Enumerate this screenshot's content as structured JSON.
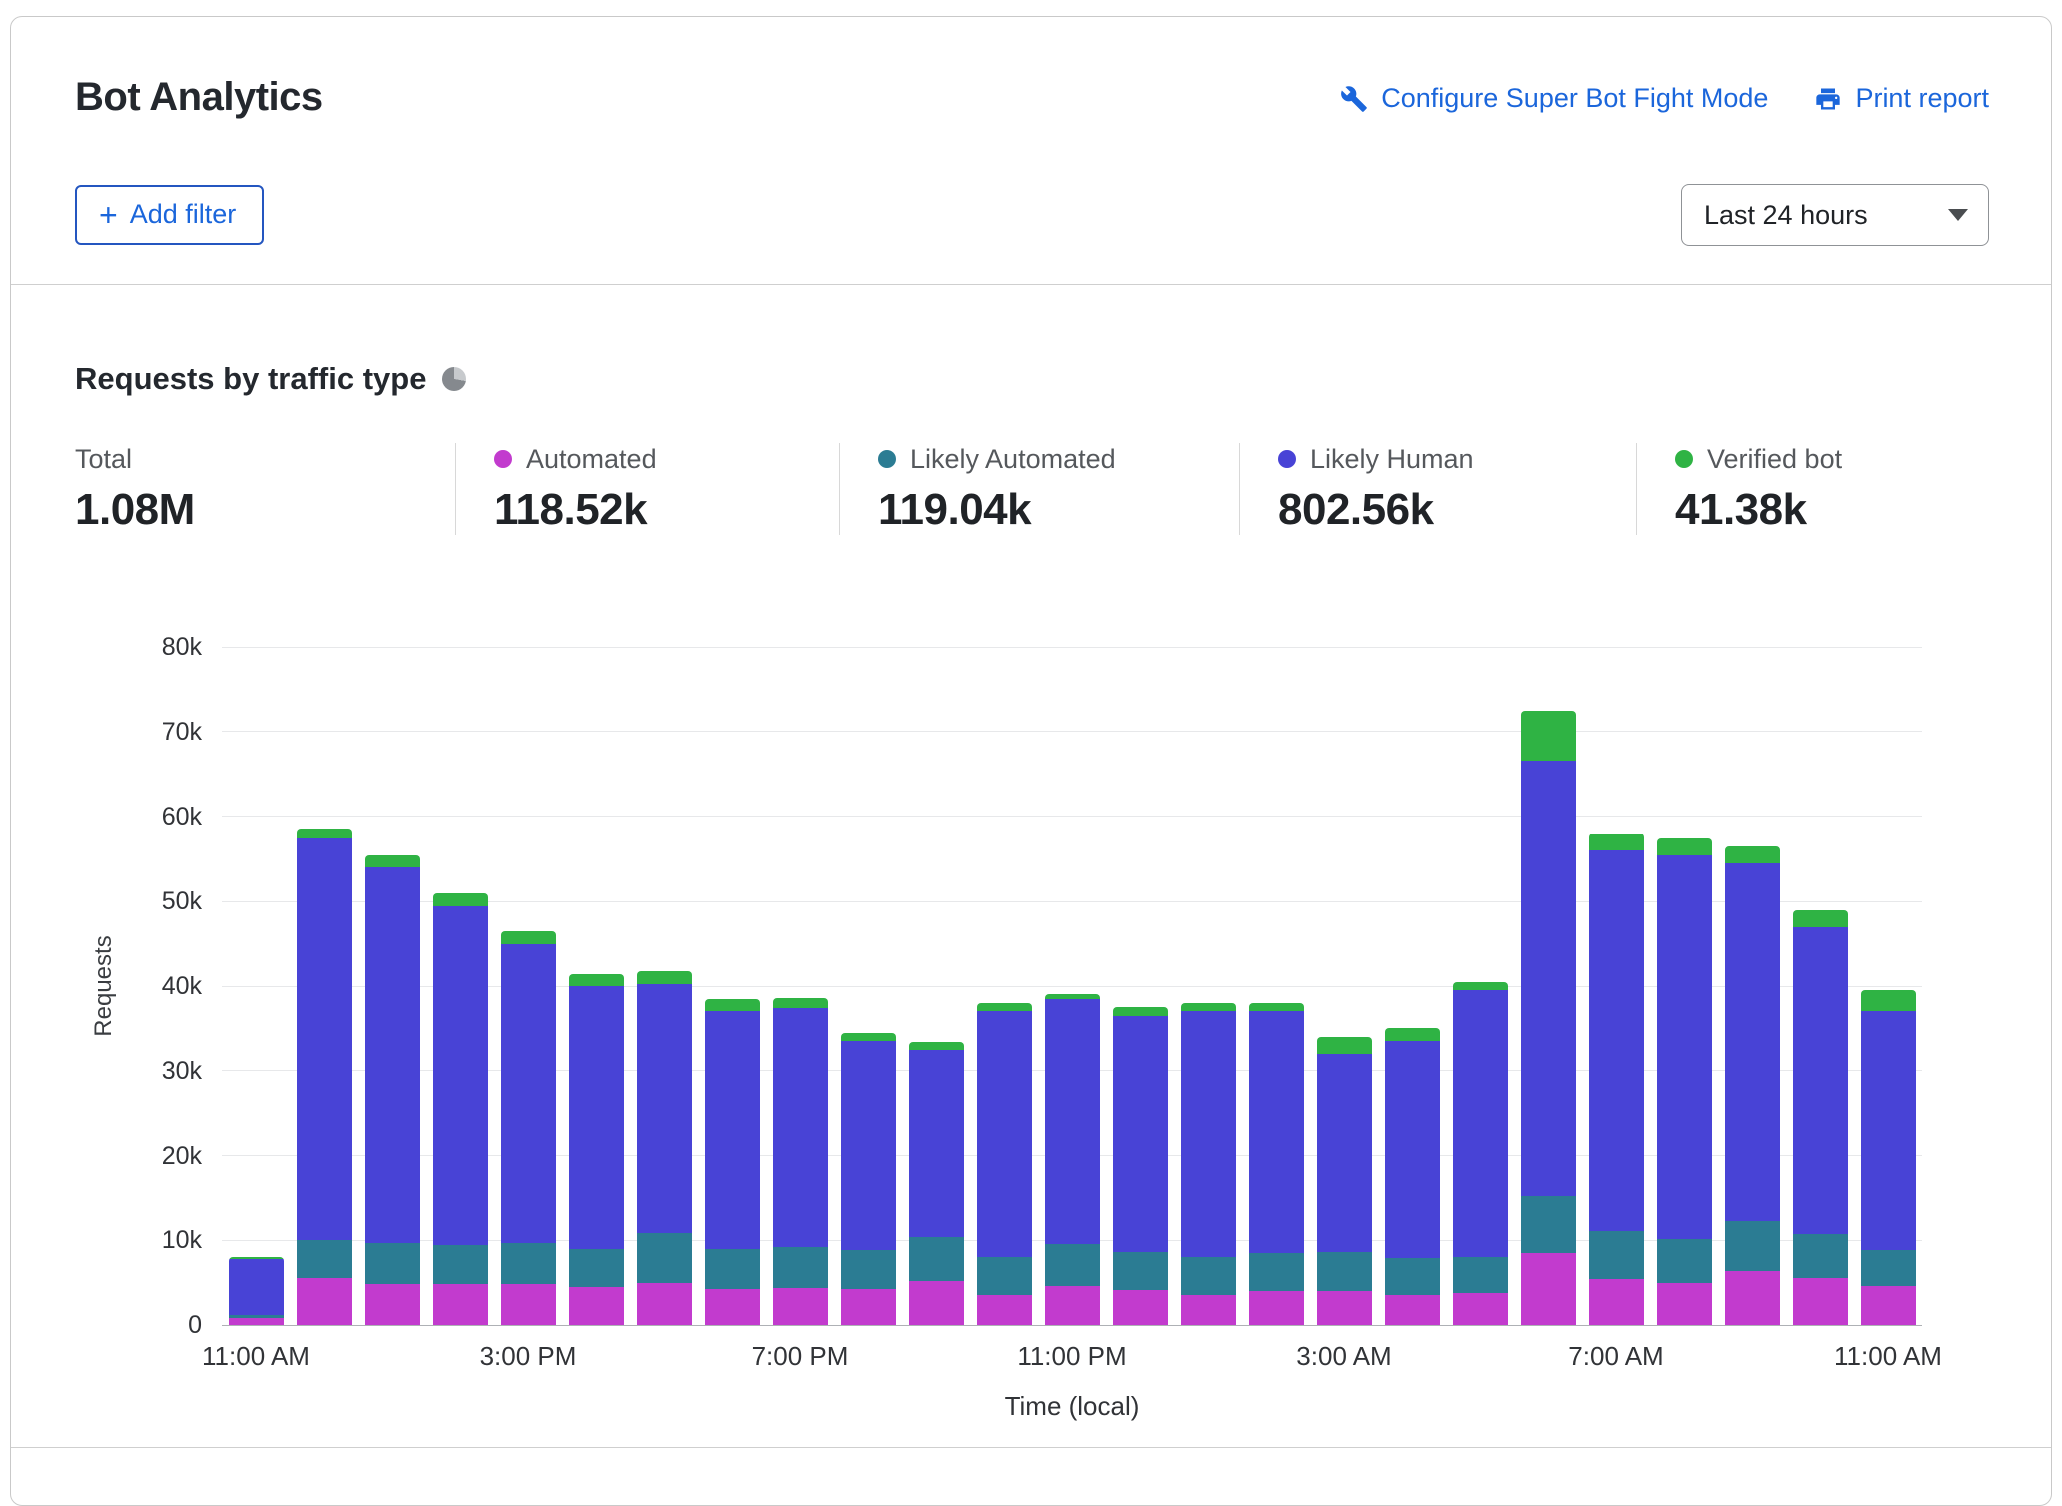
{
  "header": {
    "title": "Bot Analytics",
    "configure_link": "Configure Super Bot Fight Mode",
    "print_link": "Print report",
    "add_filter_label": "Add filter",
    "plus_glyph": "+",
    "time_range": "Last 24 hours"
  },
  "section": {
    "title": "Requests by traffic type"
  },
  "stats": [
    {
      "label": "Total",
      "value": "1.08M",
      "color": null
    },
    {
      "label": "Automated",
      "value": "118.52k",
      "color": "#c23bce"
    },
    {
      "label": "Likely Automated",
      "value": "119.04k",
      "color": "#2b7c93"
    },
    {
      "label": "Likely Human",
      "value": "802.56k",
      "color": "#4843d6"
    },
    {
      "label": "Verified bot",
      "value": "41.38k",
      "color": "#2fb344"
    }
  ],
  "colors": {
    "link_blue": "#1b66db",
    "automated": "#c23bce",
    "likely_automated": "#2b7c93",
    "likely_human": "#4843d6",
    "verified_bot": "#2fb344"
  },
  "chart_data": {
    "type": "bar",
    "stacked": true,
    "title": "Requests by traffic type",
    "xlabel": "Time (local)",
    "ylabel": "Requests",
    "ylim": [
      0,
      80000
    ],
    "grid": "horizontal",
    "legend_position": "top-stats-row",
    "y_ticks": [
      {
        "value": 0,
        "label": "0"
      },
      {
        "value": 10000,
        "label": "10k"
      },
      {
        "value": 20000,
        "label": "20k"
      },
      {
        "value": 30000,
        "label": "30k"
      },
      {
        "value": 40000,
        "label": "40k"
      },
      {
        "value": 50000,
        "label": "50k"
      },
      {
        "value": 60000,
        "label": "60k"
      },
      {
        "value": 70000,
        "label": "70k"
      },
      {
        "value": 80000,
        "label": "80k"
      }
    ],
    "x_tick_labels": [
      {
        "index": 0,
        "label": "11:00 AM"
      },
      {
        "index": 4,
        "label": "3:00 PM"
      },
      {
        "index": 8,
        "label": "7:00 PM"
      },
      {
        "index": 12,
        "label": "11:00 PM"
      },
      {
        "index": 16,
        "label": "3:00 AM"
      },
      {
        "index": 20,
        "label": "7:00 AM"
      },
      {
        "index": 24,
        "label": "11:00 AM"
      }
    ],
    "series": [
      {
        "name": "Automated",
        "color": "#c23bce",
        "values": [
          800,
          5500,
          4800,
          4800,
          4800,
          4500,
          4900,
          4200,
          4400,
          4200,
          5200,
          3600,
          4600,
          4100,
          3600,
          4000,
          4000,
          3600,
          3800,
          8500,
          5400,
          5000,
          6400,
          5600,
          4600
        ]
      },
      {
        "name": "Likely Automated",
        "color": "#2b7c93",
        "values": [
          400,
          4500,
          4900,
          4700,
          4900,
          4500,
          6000,
          4800,
          4800,
          4600,
          5200,
          4400,
          5000,
          4500,
          4400,
          4500,
          4600,
          4300,
          4200,
          6700,
          5700,
          5100,
          5900,
          5100,
          4300
        ]
      },
      {
        "name": "Likely Human",
        "color": "#4843d6",
        "values": [
          6600,
          47500,
          44300,
          40000,
          35300,
          31000,
          29300,
          28000,
          28200,
          24700,
          22000,
          29000,
          28900,
          27900,
          29000,
          28500,
          23400,
          25600,
          31500,
          51300,
          44900,
          45400,
          42200,
          36300,
          28100
        ]
      },
      {
        "name": "Verified bot",
        "color": "#2fb344",
        "values": [
          200,
          1000,
          1500,
          1500,
          1500,
          1400,
          1600,
          1500,
          1200,
          1000,
          1000,
          1000,
          500,
          1000,
          1000,
          1000,
          2000,
          1500,
          1000,
          6000,
          2000,
          2000,
          2000,
          2000,
          2500
        ]
      }
    ]
  }
}
